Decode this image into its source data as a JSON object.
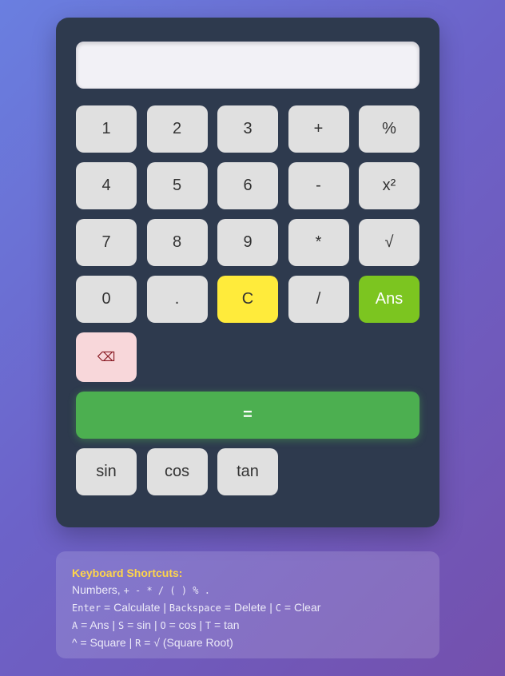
{
  "display": {
    "value": "",
    "placeholder": ""
  },
  "keys": {
    "one": "1",
    "two": "2",
    "three": "3",
    "plus": "+",
    "percent": "%",
    "four": "4",
    "five": "5",
    "six": "6",
    "minus": "-",
    "square": "x²",
    "seven": "7",
    "eight": "8",
    "nine": "9",
    "multiply": "*",
    "sqrt": "√",
    "zero": "0",
    "dot": ".",
    "clear": "C",
    "divide": "/",
    "ans": "Ans",
    "backspace": "⌫",
    "equals": "=",
    "sin": "sin",
    "cos": "cos",
    "tan": "tan"
  },
  "shortcuts": {
    "title": "Keyboard Shortcuts:",
    "line1": {
      "text": "Numbers,",
      "keys": "+ - * / ( ) % ."
    },
    "line2": {
      "enter_key": "Enter",
      "enter_desc": " = Calculate | ",
      "backspace_key": "Backspace",
      "backspace_desc": " = Delete | ",
      "c_key": "C",
      "c_desc": " = Clear"
    },
    "line3": {
      "a_key": "A",
      "a_desc": " = Ans | ",
      "s_key": "S",
      "s_desc": " = sin | ",
      "o_key": "O",
      "o_desc": " = cos | ",
      "t_key": "T",
      "t_desc": " = tan"
    },
    "line4": {
      "caret": "^",
      "caret_desc": " = Square | ",
      "r_key": "R",
      "r_desc": " = √ (Square Root)"
    }
  },
  "colors": {
    "calculator_bg": "#2e3a4e",
    "key_bg": "#e0e0e0",
    "clear_bg": "#ffeb3b",
    "ans_bg": "#7cc520",
    "backspace_bg": "#f8d7da",
    "equals_bg": "#4caf50",
    "shortcut_title": "#ffd54a"
  }
}
